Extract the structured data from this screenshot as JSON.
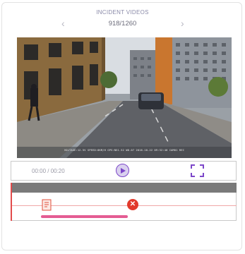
{
  "header": {
    "title": "INCIDENT VIDEOS",
    "counter": "918/1260",
    "prev_icon": "‹",
    "next_icon": "›"
  },
  "video": {
    "overlay_text": "VOLTAGE:12.5V  SPEED:0KM/H  GPS:N51.52 W0.07  2016-10-22  09:32:40  CAM01  REC"
  },
  "player": {
    "time": "00:00 / 00:20",
    "accent_color": "#7c46c9"
  },
  "timeline": {
    "playhead_color": "#e24b4b",
    "clip_color": "#e45c93",
    "marker_color": "#e23a2c",
    "x_glyph": "✕"
  }
}
